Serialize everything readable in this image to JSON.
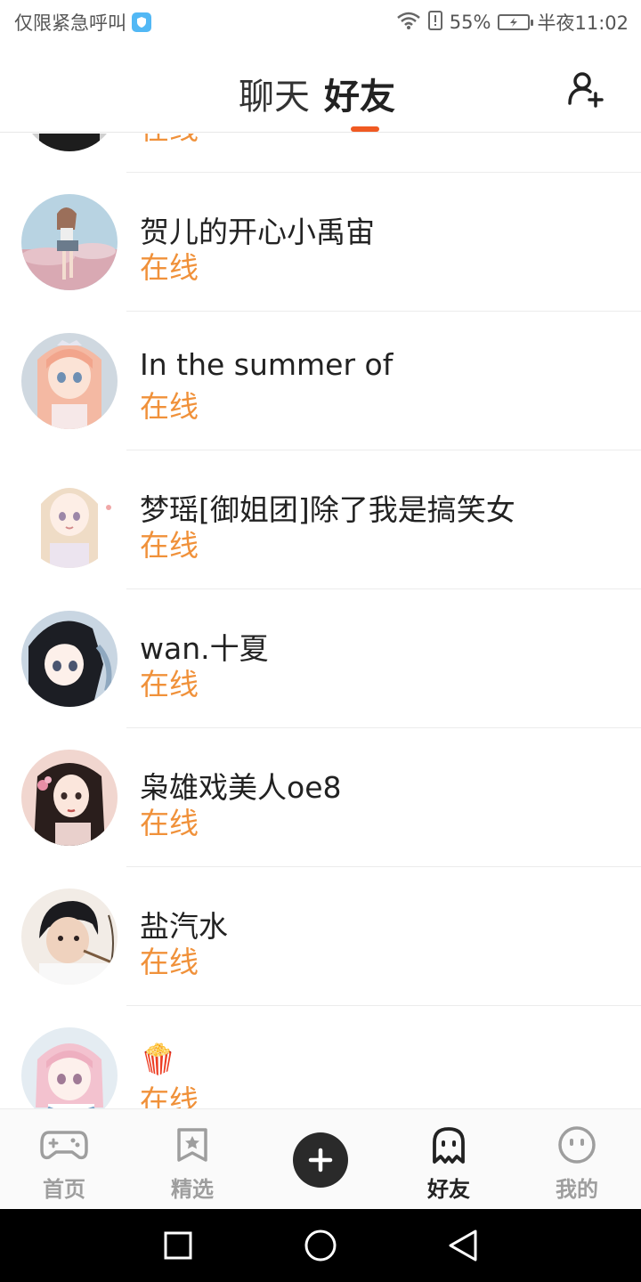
{
  "status_bar": {
    "carrier": "仅限紧急呼叫",
    "battery": "55%",
    "time": "半夜11:02"
  },
  "header": {
    "tabs": [
      {
        "label": "聊天",
        "active": false
      },
      {
        "label": "好友",
        "active": true
      }
    ],
    "accent_color": "#f05a22"
  },
  "friends": [
    {
      "name": "",
      "status": "在线"
    },
    {
      "name": "贺儿的开心小禹宙",
      "status": "在线"
    },
    {
      "name": "In the summer of",
      "status": "在线"
    },
    {
      "name": "梦瑶[御姐团]除了我是搞笑女",
      "status": "在线"
    },
    {
      "name": "wan.十夏",
      "status": "在线"
    },
    {
      "name": "枭雄戏美人oe8",
      "status": "在线"
    },
    {
      "name": "盐汽水",
      "status": "在线"
    },
    {
      "name": "🍿",
      "status": "在线"
    }
  ],
  "status_color": "#f0913a",
  "bottom_nav": {
    "items": [
      {
        "label": "首页",
        "icon": "gamepad-icon",
        "active": false
      },
      {
        "label": "精选",
        "icon": "star-bookmark-icon",
        "active": false
      },
      {
        "label": "",
        "icon": "plus-icon",
        "active": false
      },
      {
        "label": "好友",
        "icon": "ghost-icon",
        "active": true
      },
      {
        "label": "我的",
        "icon": "smiley-icon",
        "active": false
      }
    ]
  }
}
